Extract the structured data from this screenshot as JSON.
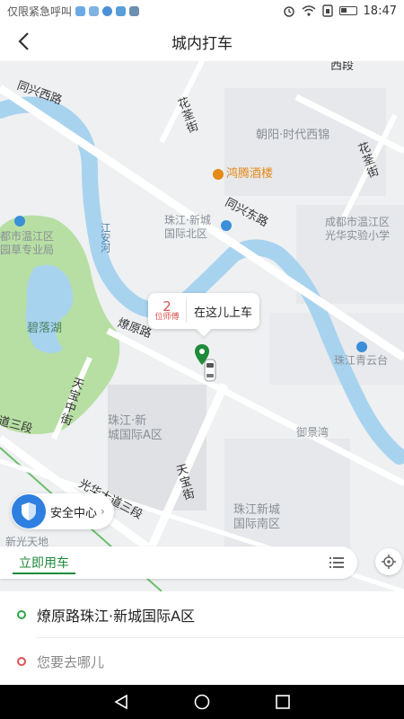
{
  "status_bar": {
    "carrier": "仅限紧急呼叫",
    "time": "18:47"
  },
  "header": {
    "title": "城内打车",
    "back_icon": "chevron-left-icon"
  },
  "map": {
    "labels": {
      "tongxing_west_road": "同兴西路",
      "xi_section": "西段",
      "huaxin_street": "花荃街",
      "chaoyang": "朝阳·时代西锦",
      "hongteng_hotel": "鸿腾酒楼",
      "huatian_street": "花荃街",
      "tongxing_east_road": "同兴东路",
      "wenjiang_bureau": "都市温江区\n园草专业局",
      "jiang_an_river": "江安河",
      "zhujiang_north": "珠江·新城\n国际北区",
      "guanghua_school": "成都市温江区\n光华实验小学",
      "biluo_lake": "碧落湖",
      "liaoyuan_road": "燎原路",
      "zhujiang_qingyun": "珠江青云台",
      "tianbao_middle": "天宝中街",
      "zhujiang_a": "珠江·新\n城国际A区",
      "yujing_bay": "御景湾",
      "dao_san_duan": "道三段",
      "guanghua_road": "光华大道三段",
      "tianbao_street": "天宝街",
      "zhujiang_south": "珠江新城\n国际南区",
      "xinguang_tiandi": "新光天地"
    }
  },
  "pickup": {
    "driver_count": "2",
    "driver_unit": "位师傅",
    "label": "在这儿上车"
  },
  "safety": {
    "label": "安全中心"
  },
  "tabs": {
    "now": "立即用车"
  },
  "address": {
    "start": "燎原路珠江·新城国际A区",
    "destination_placeholder": "您要去哪儿"
  },
  "colors": {
    "accent": "#1f8a3b",
    "start_dot": "#2aa745",
    "end_dot": "#e05252",
    "safety_blue": "#2f7fe0",
    "water": "#a8d3ef",
    "park": "#b7dfa3"
  }
}
